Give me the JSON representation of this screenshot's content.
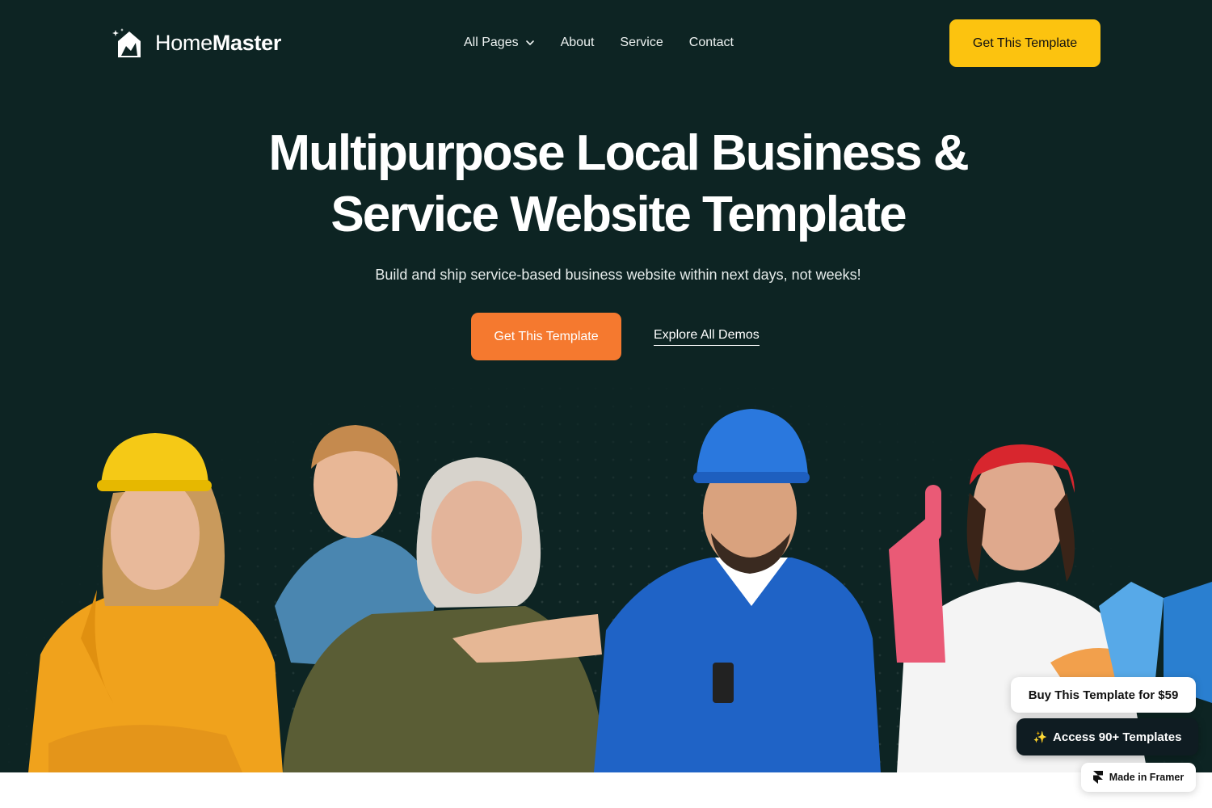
{
  "brand": {
    "name_light": "Home",
    "name_bold": "Master",
    "logo_icon": "house-sparkle-icon"
  },
  "nav": {
    "items": [
      {
        "label": "All Pages",
        "has_dropdown": true
      },
      {
        "label": "About"
      },
      {
        "label": "Service"
      },
      {
        "label": "Contact"
      }
    ],
    "cta_label": "Get This Template"
  },
  "hero": {
    "headline_line1": "Multipurpose Local Business &",
    "headline_line2": "Service Website Template",
    "subheadline": "Build and ship service-based business website within next days, not weeks!",
    "primary_cta": "Get This Template",
    "secondary_cta": "Explore All Demos"
  },
  "floating": {
    "buy_label": "Buy This Template for $59",
    "access_label": "Access 90+ Templates",
    "framer_label": "Made in Framer"
  },
  "colors": {
    "background": "#0d2423",
    "accent_yellow": "#fcc30f",
    "accent_orange": "#f5792f",
    "dark_badge": "#0f1c22"
  }
}
